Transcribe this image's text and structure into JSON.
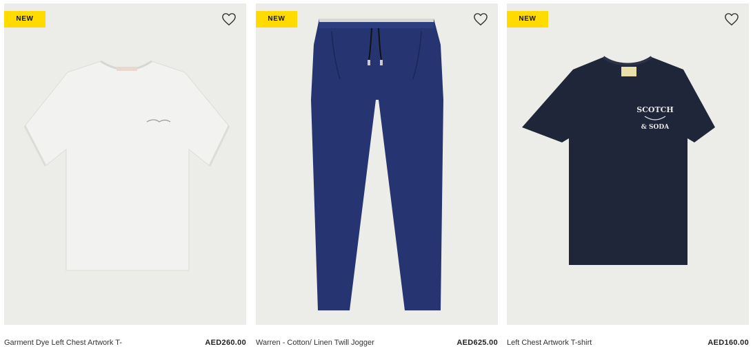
{
  "products": [
    {
      "badge": "NEW",
      "name": "Garment Dye Left Chest Artwork T-",
      "price": "AED260.00",
      "color": "#eeeeec"
    },
    {
      "badge": "NEW",
      "name": "Warren - Cotton/ Linen Twill Jogger",
      "price": "AED625.00",
      "color": "#263572"
    },
    {
      "badge": "NEW",
      "name": "Left Chest Artwork T-shirt",
      "price": "AED160.00",
      "color": "#20263a"
    }
  ],
  "icons": {
    "wishlist": "heart-outline-icon"
  },
  "colors": {
    "badge_bg": "#ffdb00",
    "card_bg": "#ecede8"
  },
  "logo_text": {
    "line1": "SCOTCH",
    "line2": "& SODA"
  }
}
